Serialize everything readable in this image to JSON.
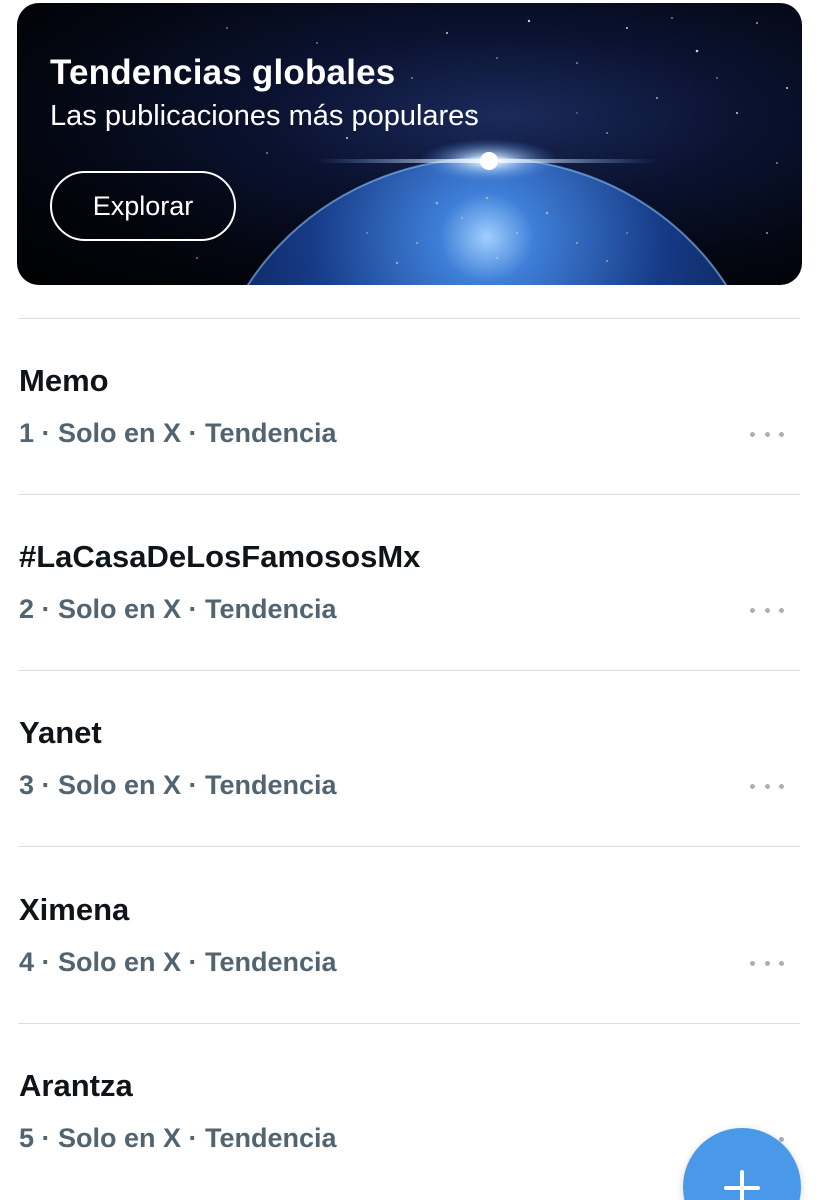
{
  "banner": {
    "title": "Tendencias globales",
    "subtitle": "Las publicaciones más populares",
    "button_label": "Explorar"
  },
  "trends": [
    {
      "name": "Memo",
      "meta": "1 · Solo en X · Tendencia"
    },
    {
      "name": "#LaCasaDeLosFamososMx",
      "meta": "2 · Solo en X · Tendencia"
    },
    {
      "name": "Yanet",
      "meta": "3 · Solo en X · Tendencia"
    },
    {
      "name": "Ximena",
      "meta": "4 · Solo en X · Tendencia"
    },
    {
      "name": "Arantza",
      "meta": "5 · Solo en X · Tendencia"
    }
  ],
  "icons": {
    "more": "more-horizontal-icon",
    "compose": "plus-icon"
  },
  "colors": {
    "accent": "#4a99e9",
    "text_primary": "#0f1419",
    "text_secondary": "#536471"
  }
}
